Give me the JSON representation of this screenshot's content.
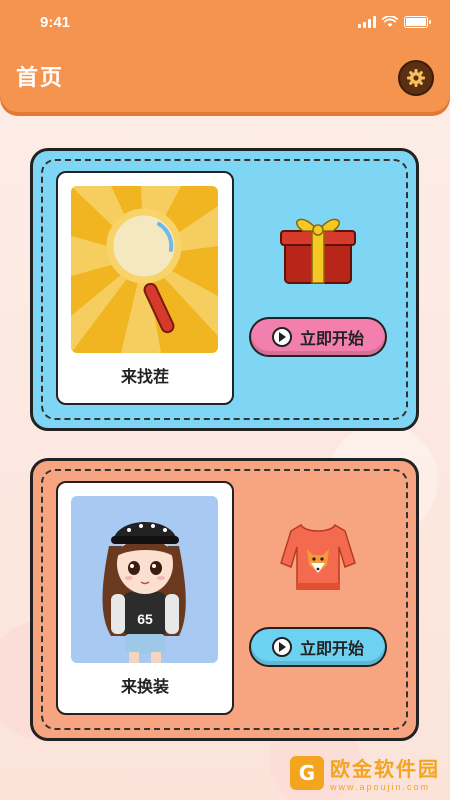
{
  "status_bar": {
    "time": "9:41"
  },
  "header": {
    "title": "首页",
    "settings_icon": "gear-icon"
  },
  "cards": [
    {
      "theme_color": "#7fd6f4",
      "thumbnail_icon": "magnifier-icon",
      "label": "来找茬",
      "decoration_icon": "gift-box-icon",
      "button_label": "立即开始",
      "button_color": "#f27fae"
    },
    {
      "theme_color": "#f7a481",
      "thumbnail_icon": "dressup-girl-illustration",
      "label": "来换装",
      "decoration_icon": "fox-sweater-icon",
      "button_label": "立即开始",
      "button_color": "#6dd1f2"
    }
  ],
  "watermark": {
    "main": "欧金软件园",
    "sub": "www.apoujin.com"
  },
  "colors": {
    "header": "#f5944f",
    "accent_dark": "#5a2f12"
  }
}
